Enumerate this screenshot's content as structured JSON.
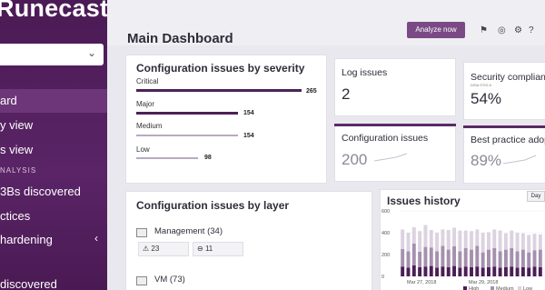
{
  "brand": {
    "logo_text": "Runecast"
  },
  "sidebar": {
    "items": [
      {
        "label": "ard",
        "top": 103
      },
      {
        "label": "y view",
        "top": 130
      },
      {
        "label": "s view",
        "top": 157
      },
      {
        "label": "3Bs discovered",
        "top": 205
      },
      {
        "label": "ctices",
        "top": 232
      },
      {
        "label": "hardening",
        "top": 258
      },
      {
        "label": "discovered",
        "top": 306
      }
    ],
    "section_label": "NALYSIS",
    "expand_arrow": "‹"
  },
  "header": {
    "title": "Main Dashboard",
    "analyze_label": "Analyze now"
  },
  "severity_card": {
    "title": "Configuration issues by severity",
    "rows": [
      {
        "label": "Critical",
        "value": "265",
        "fraction": 1.0
      },
      {
        "label": "Major",
        "value": "154",
        "fraction": 0.58
      },
      {
        "label": "Medium",
        "value": "154",
        "fraction": 0.58
      },
      {
        "label": "Low",
        "value": "98",
        "fraction": 0.37
      }
    ]
  },
  "stats": {
    "log_issues": {
      "title": "Log issues",
      "value": "2"
    },
    "security": {
      "title": "Security complianc",
      "sub": "DISA STIG 6",
      "value": "54%"
    },
    "config_issues": {
      "title": "Configuration issues",
      "value": "200"
    },
    "best_practice": {
      "title": "Best practice adopt",
      "value": "89%"
    }
  },
  "layer_card": {
    "title": "Configuration issues by layer",
    "layers": [
      {
        "label": "Management (34)",
        "warn": "23",
        "down": "11"
      },
      {
        "label": "VM (73)"
      }
    ]
  },
  "history_card": {
    "title": "Issues history",
    "range": "Day"
  },
  "chart_data": {
    "type": "bar",
    "title": "Issues history",
    "ylim": [
      0,
      600
    ],
    "yticks": [
      "600",
      "400",
      "200",
      "0"
    ],
    "xlabels": [
      "Mar 27, 2018",
      "Mar 29, 2018"
    ],
    "legend": [
      "High",
      "Medium",
      "Low"
    ],
    "series": [
      {
        "name": "High",
        "color": "#4a1f55",
        "values": [
          90,
          80,
          100,
          85,
          90,
          95,
          80,
          90,
          85,
          95,
          80,
          90,
          85,
          90,
          80,
          85,
          90,
          80,
          85,
          90,
          80,
          85,
          80,
          90,
          85
        ]
      },
      {
        "name": "Medium",
        "color": "#a590ae",
        "values": [
          160,
          150,
          200,
          140,
          180,
          170,
          150,
          190,
          160,
          180,
          150,
          170,
          160,
          190,
          140,
          160,
          170,
          150,
          160,
          170,
          150,
          160,
          140,
          150,
          160
        ]
      },
      {
        "name": "Low",
        "color": "#dcd2e0",
        "values": [
          180,
          170,
          150,
          190,
          200,
          160,
          170,
          150,
          180,
          170,
          190,
          160,
          170,
          150,
          180,
          160,
          170,
          190,
          150,
          160,
          170,
          150,
          160,
          150,
          140
        ]
      }
    ]
  }
}
